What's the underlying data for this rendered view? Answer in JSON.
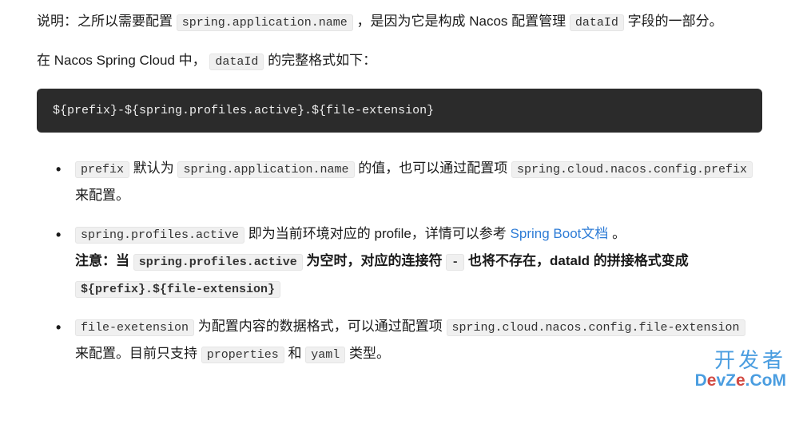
{
  "para1": {
    "pre1": "说明：之所以需要配置 ",
    "code1": "spring.application.name",
    "mid1": " ，是因为它是构成 Nacos 配置管理 ",
    "code2": "dataId",
    "post1": " 字段的一部分。"
  },
  "para2": {
    "pre1": "在 Nacos Spring Cloud 中，",
    "code1": "dataId",
    "post1": " 的完整格式如下："
  },
  "codeblock": "${prefix}-${spring.profiles.active}.${file-extension}",
  "list": {
    "item1": {
      "code1": "prefix",
      "text1": " 默认为 ",
      "code2": "spring.application.name",
      "text2": " 的值，也可以通过配置项 ",
      "code3": "spring.cloud.nacos.config.prefix",
      "text3": " 来配置。"
    },
    "item2": {
      "code1": "spring.profiles.active",
      "text1": " 即为当前环境对应的 profile，详情可以参考 ",
      "link1": "Spring Boot文档",
      "text2": "。",
      "bold1": "注意：当 ",
      "code2": "spring.profiles.active",
      "bold2": " 为空时，对应的连接符 ",
      "code_dash": "-",
      "bold3": " 也将不存在，dataId 的拼接格式变成 ",
      "code3": "${prefix}.${file-extension}"
    },
    "item3": {
      "code1": "file-exetension",
      "text1": " 为配置内容的数据格式，可以通过配置项 ",
      "code2": "spring.cloud.nacos.config.file-extension",
      "text2": " 来配置。目前只支持 ",
      "code3": "properties",
      "text3": " 和 ",
      "code4": "yaml",
      "text4": " 类型。"
    }
  },
  "watermark": {
    "cn": "开发者",
    "en_pre": "D",
    "en_red": "e",
    "en_mid": "vZ",
    "en_red2": "e",
    "en_post": ".CoM"
  }
}
